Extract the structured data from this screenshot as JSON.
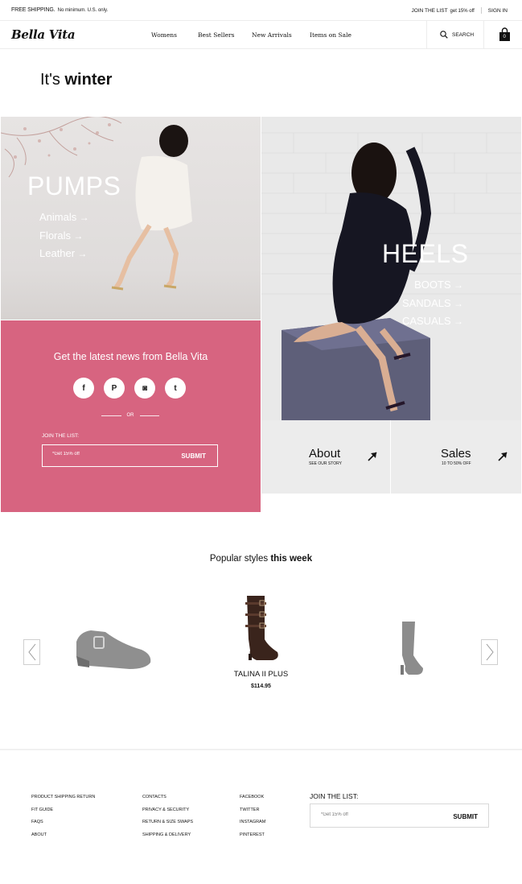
{
  "topbar": {
    "shipping_title": "FREE SHIPPING.",
    "shipping_note": "No minimum.  U.S. only.",
    "join": "JOIN THE LIST",
    "join_offer": "get 15% off",
    "sign_in": "SIGN IN"
  },
  "nav": {
    "logo": "Bella Vita",
    "items": [
      "Womens",
      "Best Sellers",
      "New Arrivals",
      "Items on Sale"
    ],
    "search": "SEARCH",
    "bag_count": "0"
  },
  "season": {
    "lead": "It's",
    "strong": "winter"
  },
  "pumps": {
    "title": "PUMPS",
    "links": [
      "Animals",
      "Florals",
      "Leather"
    ]
  },
  "heels": {
    "title": "HEELS",
    "links": [
      "BOOTS",
      "SANDALS",
      "CASUALS"
    ]
  },
  "newsletter": {
    "headline": "Get the latest news from Bella Vita",
    "social": [
      "f",
      "P",
      "◙",
      "t"
    ],
    "or": "OR",
    "join_label": "JOIN THE LIST:",
    "placeholder": "*Get 15% off",
    "submit": "SUBMIT"
  },
  "cards": {
    "about": {
      "title": "About",
      "sub": "SEE OUR STORY"
    },
    "sales": {
      "title": "Sales",
      "sub": "10 TO 50% OFF"
    }
  },
  "popular": {
    "lead": "Popular styles",
    "strong": "this week",
    "featured_name": "TALINA II PLUS",
    "featured_price": "$114.95"
  },
  "footer": {
    "col1": [
      "PRODUCT SHIPPING RETURN",
      "FIT GUIDE",
      "FAQS",
      "ABOUT"
    ],
    "col2": [
      "CONTACTS",
      "PRIVACY & SECURITY",
      "RETURN & SIZE SWAPS",
      "SHIPPING & DELIVERY"
    ],
    "col3": [
      "FACEBOOK",
      "TWITTER",
      "INSTAGRAM",
      "PINTEREST"
    ],
    "join_label": "JOIN THE LIST:",
    "placeholder": "*Get 15% off",
    "submit": "SUBMIT"
  },
  "colors": {
    "accent": "#d76480",
    "tile_gray": "#ececec"
  }
}
